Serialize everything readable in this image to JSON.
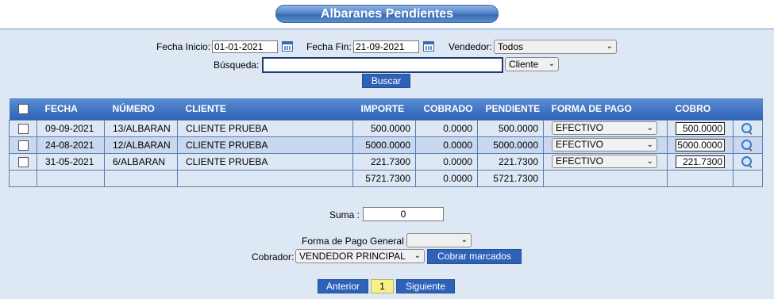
{
  "page": {
    "title": "Albaranes Pendientes"
  },
  "filters": {
    "fecha_inicio_label": "Fecha Inicio:",
    "fecha_inicio_value": "01-01-2021",
    "fecha_fin_label": "Fecha Fin:",
    "fecha_fin_value": "21-09-2021",
    "vendedor_label": "Vendedor:",
    "vendedor_value": "Todos",
    "busqueda_label": "Búsqueda:",
    "busqueda_value": "",
    "busqueda_field": "Cliente",
    "buscar_label": "Buscar"
  },
  "table": {
    "headers": [
      "FECHA",
      "NÚMERO",
      "CLIENTE",
      "IMPORTE",
      "COBRADO",
      "PENDIENTE",
      "FORMA DE PAGO",
      "COBRO"
    ],
    "rows": [
      {
        "fecha": "09-09-2021",
        "numero": "13/ALBARAN",
        "cliente": "CLIENTE PRUEBA",
        "importe": "500.0000",
        "cobrado": "0.0000",
        "pendiente": "500.0000",
        "forma_pago": "EFECTIVO",
        "cobro": "500.0000"
      },
      {
        "fecha": "24-08-2021",
        "numero": "12/ALBARAN",
        "cliente": "CLIENTE PRUEBA",
        "importe": "5000.0000",
        "cobrado": "0.0000",
        "pendiente": "5000.0000",
        "forma_pago": "EFECTIVO",
        "cobro": "5000.0000"
      },
      {
        "fecha": "31-05-2021",
        "numero": "6/ALBARAN",
        "cliente": "CLIENTE PRUEBA",
        "importe": "221.7300",
        "cobrado": "0.0000",
        "pendiente": "221.7300",
        "forma_pago": "EFECTIVO",
        "cobro": "221.7300"
      }
    ],
    "totals": {
      "importe": "5721.7300",
      "cobrado": "0.0000",
      "pendiente": "5721.7300"
    }
  },
  "summary": {
    "suma_label": "Suma :",
    "suma_value": "0",
    "forma_pago_general_label": "Forma de Pago General",
    "forma_pago_general_value": "",
    "cobrador_label": "Cobrador:",
    "cobrador_value": "VENDEDOR PRINCIPAL",
    "cobrar_label": "Cobrar marcados"
  },
  "pagination": {
    "prev_label": "Anterior",
    "current_page": "1",
    "next_label": "Siguiente"
  },
  "icons": {
    "calendar": "calendar-icon",
    "view": "magnifier-icon",
    "dropdown": "chevron-down-icon"
  },
  "colors": {
    "accent": "#2e62b8",
    "header_start": "#5b8ed2",
    "background": "#dde8f4",
    "current_page": "#f5f08a"
  }
}
